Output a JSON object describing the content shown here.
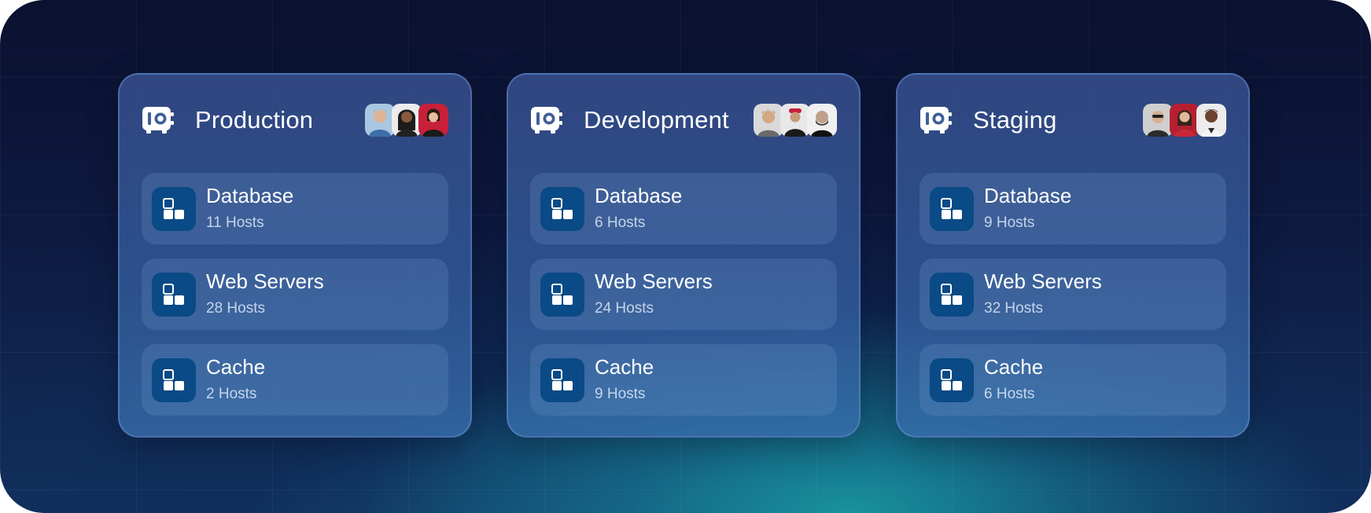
{
  "environments": [
    {
      "name": "Production",
      "groups": [
        {
          "name": "Database",
          "hosts": "11 Hosts"
        },
        {
          "name": "Web Servers",
          "hosts": "28 Hosts"
        },
        {
          "name": "Cache",
          "hosts": "2 Hosts"
        }
      ]
    },
    {
      "name": "Development",
      "groups": [
        {
          "name": "Database",
          "hosts": "6 Hosts"
        },
        {
          "name": "Web Servers",
          "hosts": "24 Hosts"
        },
        {
          "name": "Cache",
          "hosts": "9 Hosts"
        }
      ]
    },
    {
      "name": "Staging",
      "groups": [
        {
          "name": "Database",
          "hosts": "9 Hosts"
        },
        {
          "name": "Web Servers",
          "hosts": "32 Hosts"
        },
        {
          "name": "Cache",
          "hosts": "6 Hosts"
        }
      ]
    }
  ],
  "icons": {
    "environment": "vault-icon",
    "group": "server-group-icon",
    "members": "user-avatar"
  },
  "colors": {
    "group_icon_bg": "#0a4a86",
    "title_text": "#ffffff"
  }
}
